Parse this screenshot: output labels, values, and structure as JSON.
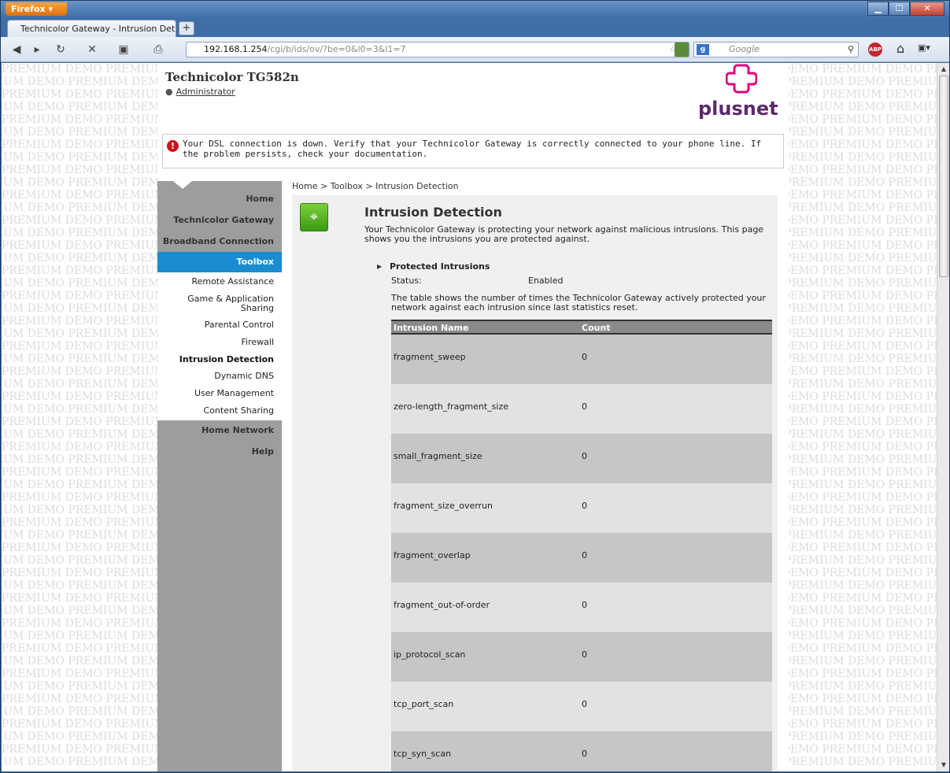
{
  "browser": {
    "menu_label": "Firefox ▾",
    "tab_title": "Technicolor Gateway - Intrusion Dete...",
    "new_tab": "+",
    "url_host": "192.168.1.254",
    "url_path": "/cgi/b/ids/ov/?be=0&l0=3&l1=7",
    "search_placeholder": "Google",
    "window_controls": [
      "minimize",
      "maximize",
      "close"
    ]
  },
  "header": {
    "device_name": "Technicolor TG582n",
    "user_link": "Administrator",
    "brand": "plusnet"
  },
  "alert": {
    "message": "Your DSL connection is down. Verify that your Technicolor Gateway is correctly connected to your phone line. If the problem persists, check your documentation."
  },
  "nav": {
    "items": [
      "Home",
      "Technicolor Gateway",
      "Broadband Connection",
      "Toolbox",
      "Home Network",
      "Help"
    ],
    "active": "Toolbox",
    "subitems": [
      "Remote Assistance",
      "Game & Application\nSharing",
      "Parental Control",
      "Firewall",
      "Intrusion Detection",
      "Dynamic DNS",
      "User Management",
      "Content Sharing"
    ],
    "current_sub": "Intrusion Detection"
  },
  "breadcrumb": "Home > Toolbox > Intrusion Detection",
  "main": {
    "title": "Intrusion Detection",
    "description": "Your Technicolor Gateway is protecting your network against malicious intrusions. This page shows you the intrusions you are protected against.",
    "section_title": "Protected Intrusions",
    "status_label": "Status:",
    "status_value": "Enabled",
    "table_description": "The table shows the number of times the Technicolor Gateway actively protected your network against each intrusion since last statistics reset.",
    "table": {
      "headers": [
        "Intrusion Name",
        "Count"
      ],
      "rows": [
        {
          "name": "fragment_sweep",
          "count": "0"
        },
        {
          "name": "zero-length_fragment_size",
          "count": "0"
        },
        {
          "name": "small_fragment_size",
          "count": "0"
        },
        {
          "name": "fragment_size_overrun",
          "count": "0"
        },
        {
          "name": "fragment_overlap",
          "count": "0"
        },
        {
          "name": "fragment_out-of-order",
          "count": "0"
        },
        {
          "name": "ip_protocol_scan",
          "count": "0"
        },
        {
          "name": "tcp_port_scan",
          "count": "0"
        },
        {
          "name": "tcp_syn_scan",
          "count": "0"
        }
      ]
    }
  },
  "watermark": "PREMIUM DEMO PREMIUM DEMO PREMIUM DEMO PREMIUM"
}
